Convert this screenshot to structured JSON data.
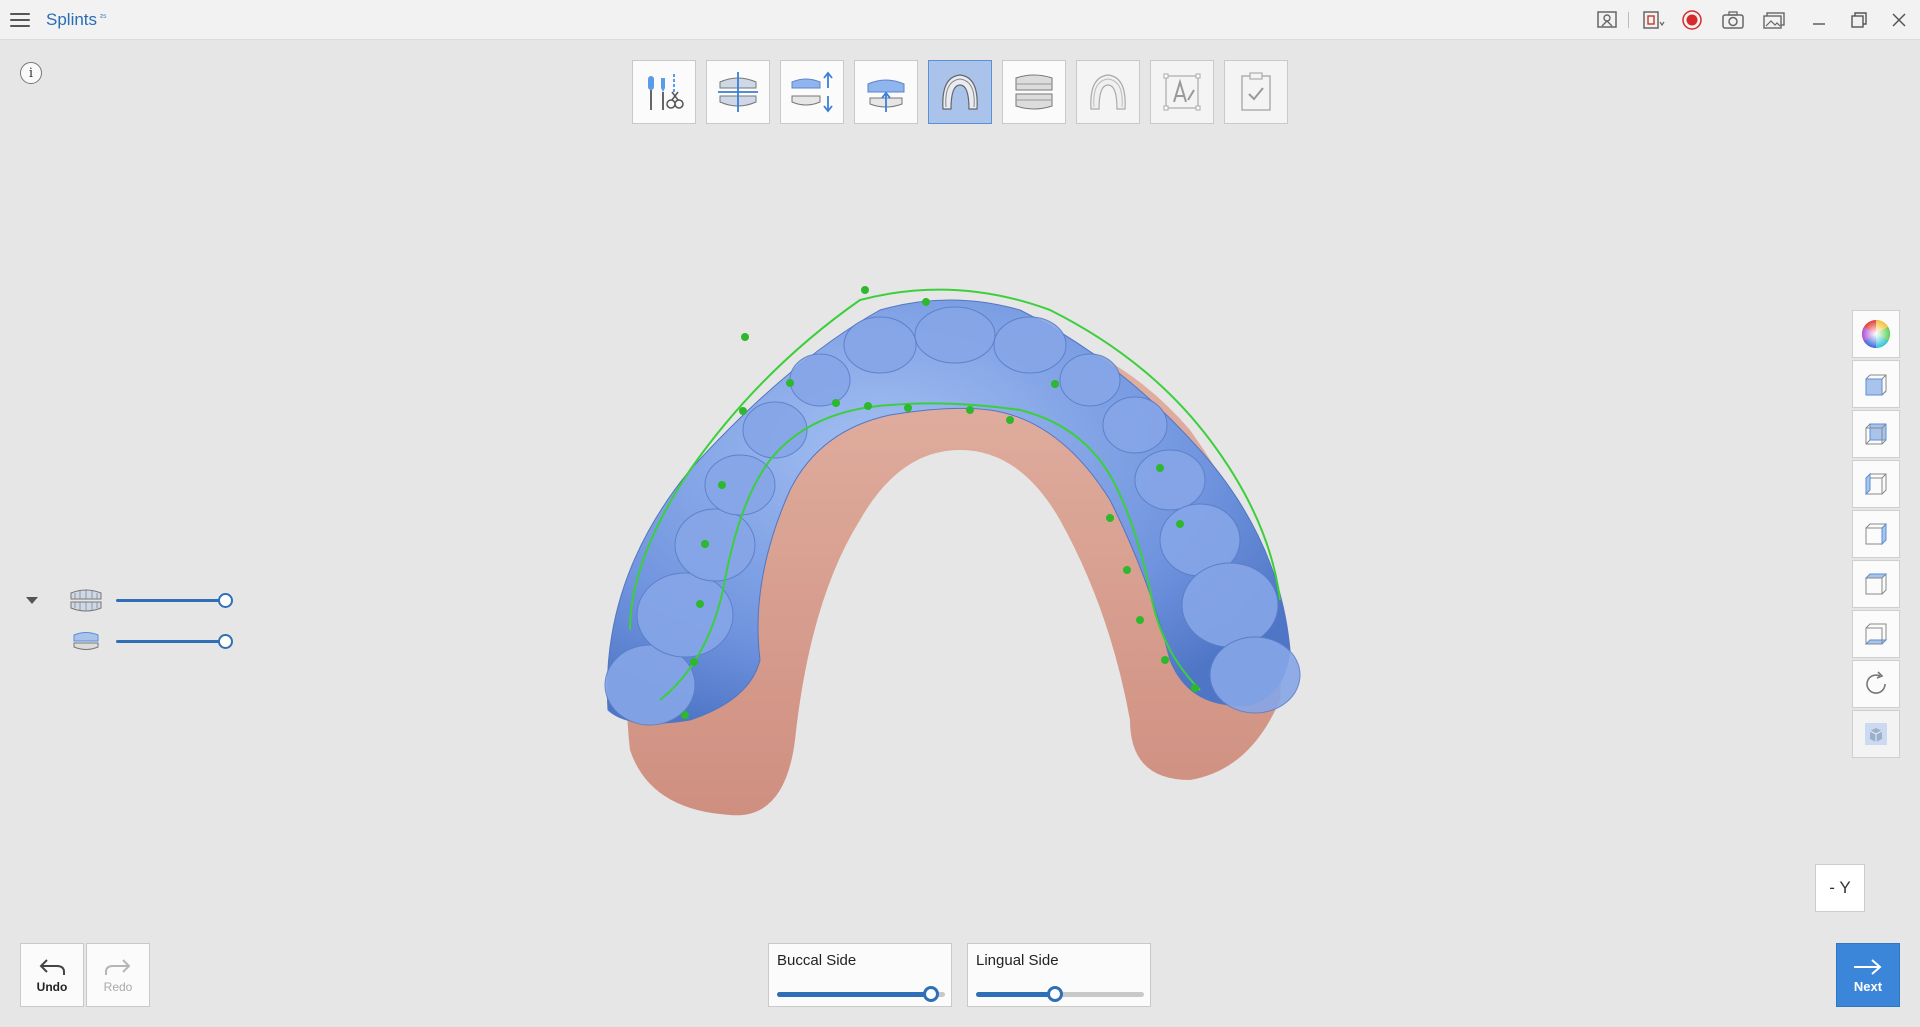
{
  "app": {
    "title": "Splints",
    "badge": "²⁵"
  },
  "titlebar_icons": [
    "help-manual-icon",
    "snapshot-region-icon",
    "record-icon",
    "camera-icon",
    "gallery-icon",
    "minimize-icon",
    "restore-icon",
    "close-icon"
  ],
  "info": {
    "label": "i"
  },
  "steps": [
    {
      "name": "trim-tools",
      "state": "normal"
    },
    {
      "name": "align-midline",
      "state": "normal"
    },
    {
      "name": "bite-separation",
      "state": "normal"
    },
    {
      "name": "insertion-path",
      "state": "normal"
    },
    {
      "name": "splint-margin",
      "state": "active"
    },
    {
      "name": "splint-thickness",
      "state": "normal"
    },
    {
      "name": "splint-design",
      "state": "disabled"
    },
    {
      "name": "text-label",
      "state": "disabled"
    },
    {
      "name": "finish",
      "state": "disabled"
    }
  ],
  "view_tools": [
    "color-wheel-icon",
    "front-view-icon",
    "back-view-icon",
    "left-view-icon",
    "right-view-icon",
    "top-view-icon",
    "bottom-view-icon",
    "reset-view-icon",
    "solid-view-icon"
  ],
  "visibility": {
    "upper": {
      "level": 1.0
    },
    "lower": {
      "level": 1.0
    }
  },
  "axis": {
    "label": "- Y"
  },
  "undo": {
    "label": "Undo"
  },
  "redo": {
    "label": "Redo"
  },
  "next": {
    "label": "Next"
  },
  "buccal": {
    "label": "Buccal Side",
    "value": 0.96
  },
  "lingual": {
    "label": "Lingual Side",
    "value": 0.47
  },
  "colors": {
    "accent": "#2f6fb8",
    "splint": "#7a9be0",
    "tissue": "#d79a8a",
    "margin_line": "#3ccf3c"
  }
}
